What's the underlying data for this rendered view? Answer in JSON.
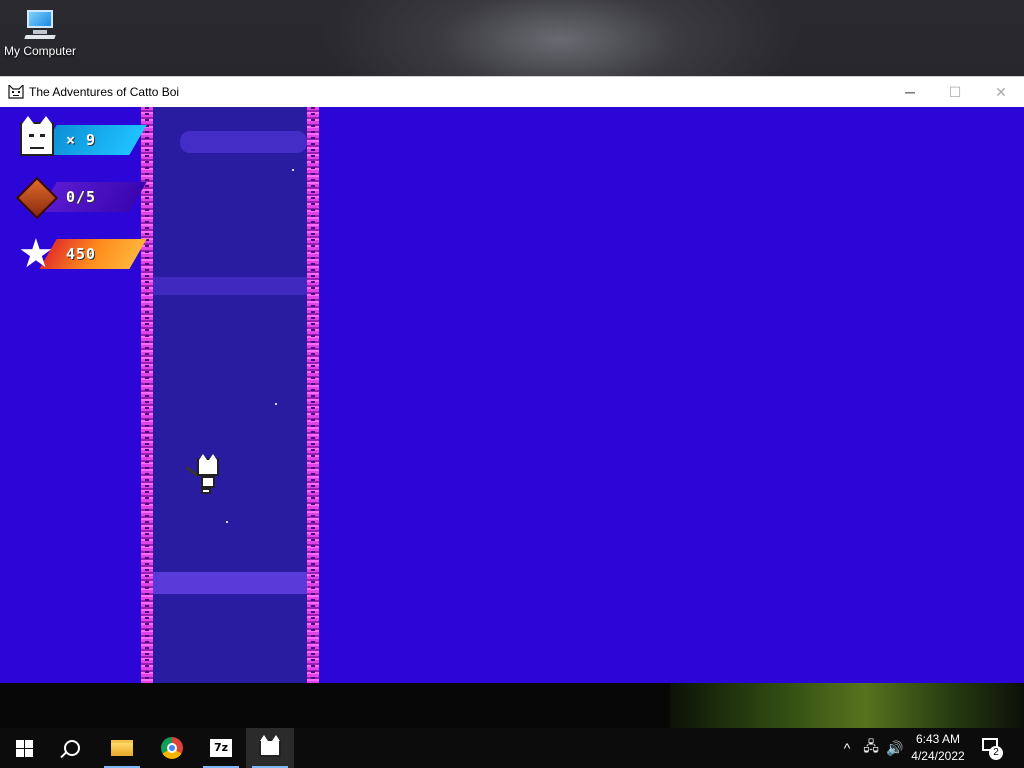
{
  "desktop": {
    "icons": [
      {
        "label": "My Computer",
        "icon": "computer-icon"
      }
    ]
  },
  "window": {
    "title": "The Adventures of Catto Boi",
    "icon": "cat-app-icon",
    "controls": {
      "minimize": "─",
      "maximize": "☐",
      "close": "✕"
    }
  },
  "game": {
    "hud": {
      "lives": "× 9",
      "gems": "0/5",
      "score": "450"
    },
    "colors": {
      "background": "#2b06d6",
      "shaft": "#2a1ca0",
      "wall": "#e044e8"
    }
  },
  "taskbar": {
    "pinned": [
      {
        "name": "file-explorer",
        "icon": "folder-icon"
      },
      {
        "name": "chrome",
        "icon": "chrome-icon"
      },
      {
        "name": "7zip",
        "icon": "7zip-icon",
        "text": "7z"
      },
      {
        "name": "catto-boi",
        "icon": "cat-icon"
      }
    ],
    "tray": {
      "chevron": "^",
      "network": "🖧",
      "volume": "🔊"
    },
    "clock": {
      "time": "6:43 AM",
      "date": "4/24/2022"
    },
    "notifications": {
      "count": "2"
    }
  }
}
